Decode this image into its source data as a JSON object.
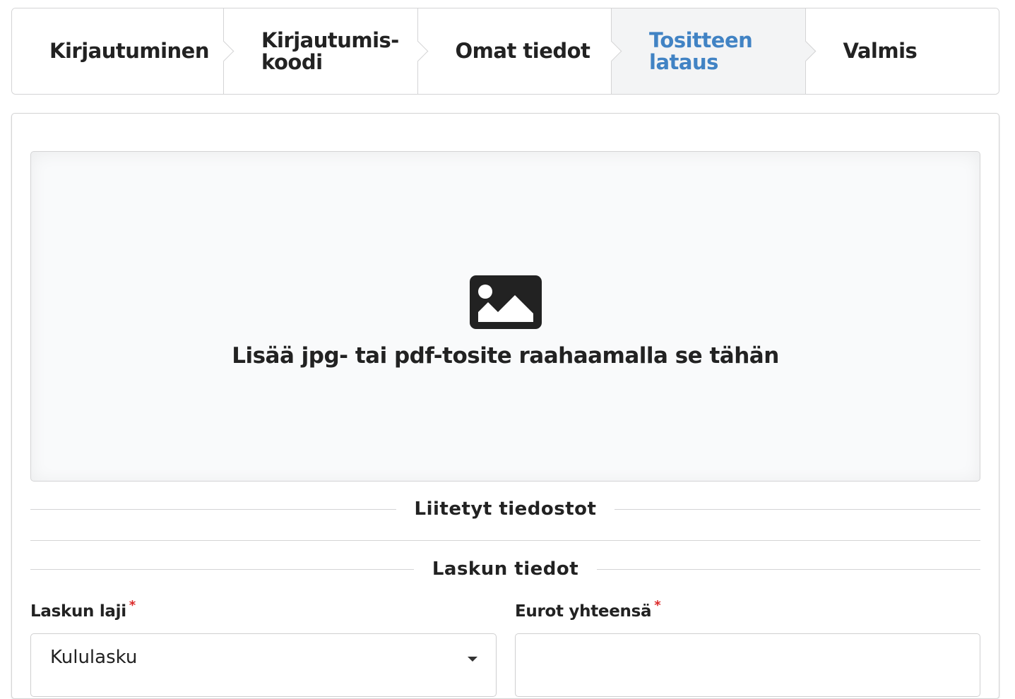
{
  "steps": [
    {
      "label": "Kirjautuminen",
      "active": false
    },
    {
      "label": "Kirjautumis-\nkoodi",
      "active": false
    },
    {
      "label": "Omat tiedot",
      "active": false
    },
    {
      "label": "Tositteen\nlataus",
      "active": true
    },
    {
      "label": "Valmis",
      "active": false
    }
  ],
  "dropzone": {
    "icon": "image-icon",
    "text": "Lisää jpg- tai pdf-tosite raahaamalla se tähän"
  },
  "attachments": {
    "heading": "Liitetyt tiedostot"
  },
  "invoice": {
    "heading": "Laskun tiedot",
    "type_label": "Laskun laji",
    "type_value": "Kululasku",
    "total_label": "Eurot yhteensä",
    "total_value": "",
    "required_mark": "*"
  },
  "colors": {
    "accent": "#4183c4",
    "required": "#db2828",
    "active_step_bg": "#f3f4f5"
  }
}
